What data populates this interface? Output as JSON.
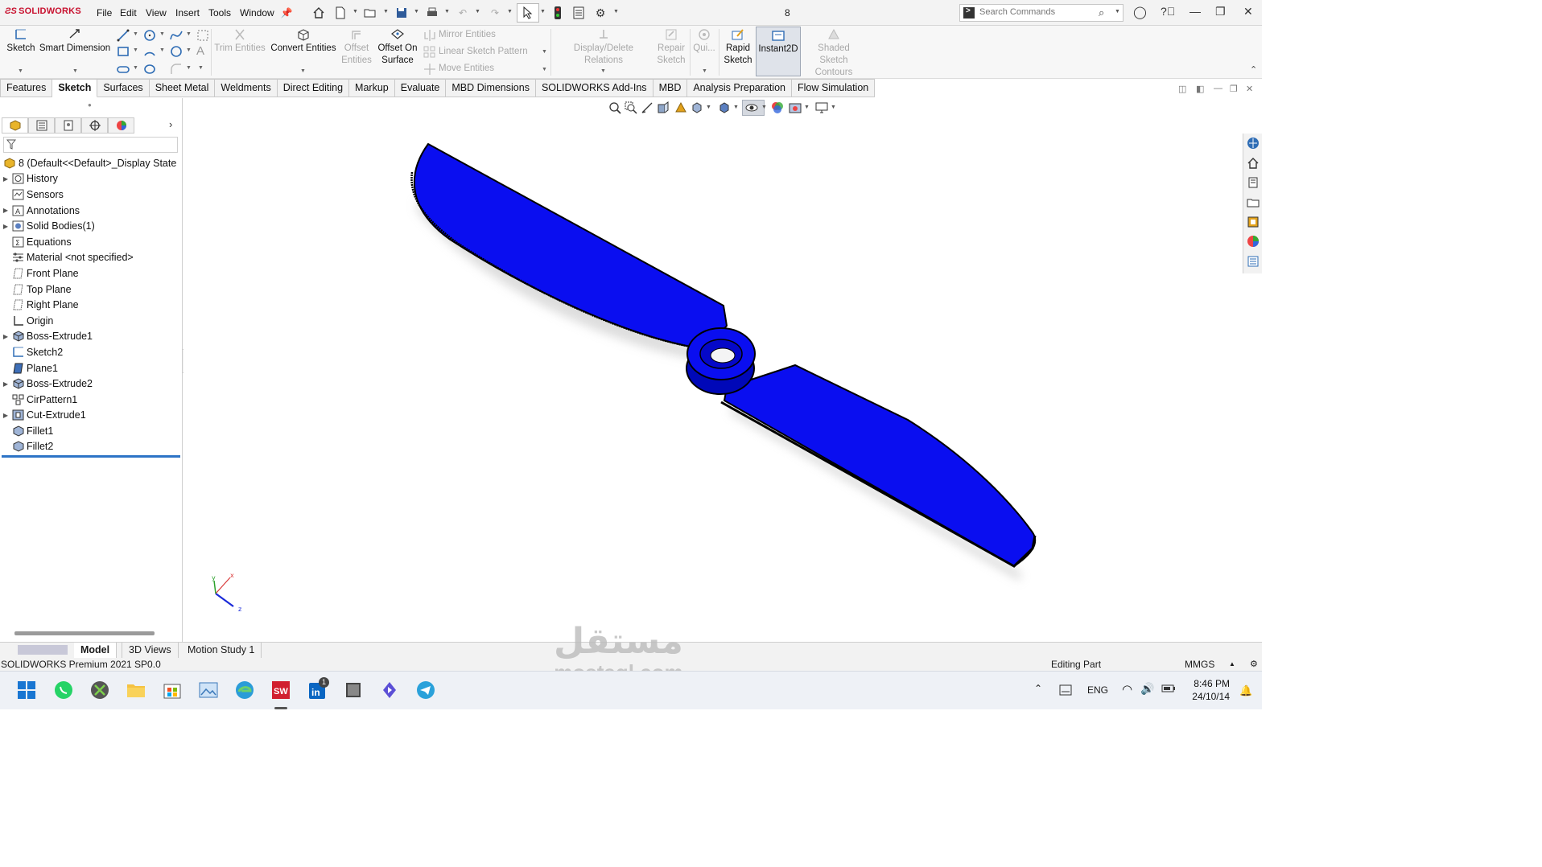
{
  "app": {
    "logo": "SOLIDWORKS",
    "document_title": "8"
  },
  "menu": [
    "File",
    "Edit",
    "View",
    "Insert",
    "Tools",
    "Window"
  ],
  "search": {
    "placeholder": "Search Commands"
  },
  "commands": {
    "sketch": "Sketch",
    "smart_dimension": "Smart Dimension",
    "trim_entities": "Trim Entities",
    "convert_entities": "Convert Entities",
    "offset_entities": [
      "Offset",
      "Entities"
    ],
    "offset_on_surface": [
      "Offset On",
      "Surface"
    ],
    "mirror_entities": "Mirror Entities",
    "linear_sketch_pattern": "Linear Sketch Pattern",
    "move_entities": "Move Entities",
    "display_delete_relations": "Display/Delete Relations",
    "repair_sketch": [
      "Repair",
      "Sketch"
    ],
    "quick_snaps": "Qui...",
    "rapid_sketch": [
      "Rapid",
      "Sketch"
    ],
    "instant2d": "Instant2D",
    "shaded_sketch_contours": [
      "Shaded Sketch",
      "Contours"
    ]
  },
  "tabs": [
    "Features",
    "Sketch",
    "Surfaces",
    "Sheet Metal",
    "Weldments",
    "Direct Editing",
    "Markup",
    "Evaluate",
    "MBD Dimensions",
    "SOLIDWORKS Add-Ins",
    "MBD",
    "Analysis Preparation",
    "Flow Simulation"
  ],
  "active_tab": "Sketch",
  "feature_tree": {
    "root": "8  (Default<<Default>_Display State",
    "items": [
      {
        "label": "History",
        "icon": "history-icon",
        "expandable": true
      },
      {
        "label": "Sensors",
        "icon": "sensors-icon",
        "expandable": false
      },
      {
        "label": "Annotations",
        "icon": "annotations-icon",
        "expandable": true
      },
      {
        "label": "Solid Bodies(1)",
        "icon": "solid-bodies-icon",
        "expandable": true
      },
      {
        "label": "Equations",
        "icon": "equations-icon",
        "expandable": false
      },
      {
        "label": "Material <not specified>",
        "icon": "material-icon",
        "expandable": false
      },
      {
        "label": "Front Plane",
        "icon": "plane-icon",
        "expandable": false
      },
      {
        "label": "Top Plane",
        "icon": "plane-icon",
        "expandable": false
      },
      {
        "label": "Right Plane",
        "icon": "plane-icon",
        "expandable": false
      },
      {
        "label": "Origin",
        "icon": "origin-icon",
        "expandable": false
      },
      {
        "label": "Boss-Extrude1",
        "icon": "extrude-icon",
        "expandable": true
      },
      {
        "label": "Sketch2",
        "icon": "sketch-icon",
        "expandable": false
      },
      {
        "label": "Plane1",
        "icon": "plane-solid-icon",
        "expandable": false
      },
      {
        "label": "Boss-Extrude2",
        "icon": "extrude-icon",
        "expandable": true
      },
      {
        "label": "CirPattern1",
        "icon": "circular-pattern-icon",
        "expandable": false
      },
      {
        "label": "Cut-Extrude1",
        "icon": "cut-extrude-icon",
        "expandable": true
      },
      {
        "label": "Fillet1",
        "icon": "fillet-icon",
        "expandable": false
      },
      {
        "label": "Fillet2",
        "icon": "fillet-icon",
        "expandable": false
      }
    ]
  },
  "bottom_tabs": [
    "Model",
    "3D Views",
    "Motion Study 1"
  ],
  "status": {
    "product": "SOLIDWORKS Premium 2021 SP0.0",
    "mode": "Editing Part",
    "units": "MMGS"
  },
  "taskbar": {
    "time": "8:46 PM",
    "date": "24/10/14",
    "language": "ENG",
    "notification_badge": "1"
  },
  "watermark": {
    "arabic": "مستقل",
    "latin": "mostaql.com"
  },
  "colors": {
    "part_body": "#0a0ef0",
    "part_edge": "#000000",
    "selection_blue": "#2d74c6",
    "brand_red": "#c8102e"
  }
}
